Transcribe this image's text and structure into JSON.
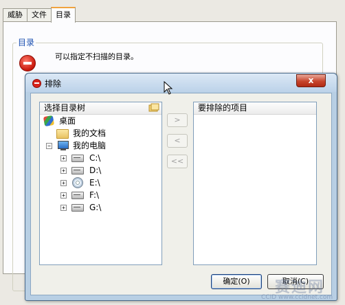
{
  "background_window": {
    "tabs": [
      {
        "label": "威胁"
      },
      {
        "label": "文件"
      },
      {
        "label": "目录"
      }
    ],
    "group_title": "目录",
    "description": "可以指定不扫描的目录。"
  },
  "dialog": {
    "title": "排除",
    "close_label": "x",
    "tree_header": "选择目录树",
    "excluded_header": "要排除的项目",
    "tree": [
      {
        "label": "桌面"
      },
      {
        "label": "我的文档"
      },
      {
        "label": "我的电脑",
        "expander": "−"
      },
      {
        "label": "C:\\",
        "expander": "+"
      },
      {
        "label": "D:\\",
        "expander": "+"
      },
      {
        "label": "E:\\",
        "expander": "+"
      },
      {
        "label": "F:\\",
        "expander": "+"
      },
      {
        "label": "G:\\",
        "expander": "+"
      }
    ],
    "move_buttons": {
      "add": ">",
      "remove": "<",
      "remove_all": "<<"
    },
    "ok_label": "确定(O)",
    "cancel_label": "取消(C)"
  },
  "watermark": {
    "main": "赛迪网",
    "sub": "CCID www.ccidnet.com"
  },
  "colors": {
    "accent_tab": "#f0a33d",
    "title_blue": "#1a4fb0",
    "close_red": "#c7452c"
  }
}
